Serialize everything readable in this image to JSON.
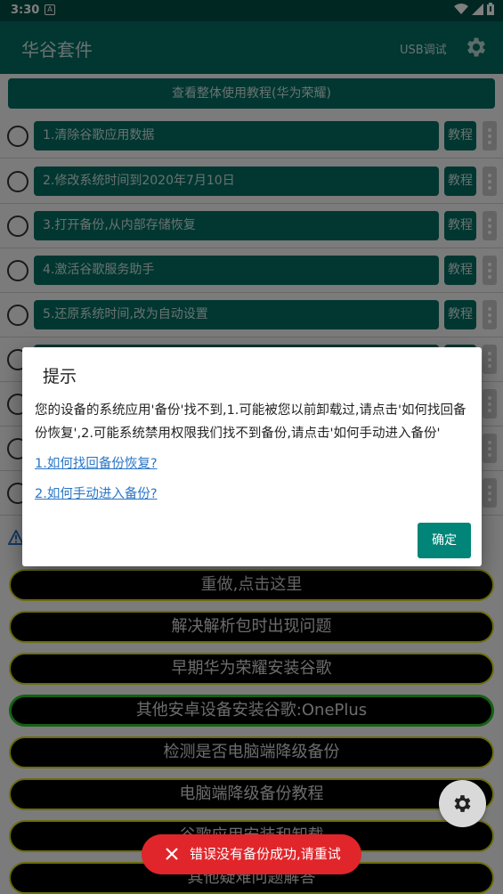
{
  "status_bar": {
    "time": "3:30",
    "notification_icon": "A"
  },
  "app_bar": {
    "title": "华谷套件",
    "usb_debug": "USB调试",
    "settings_icon": "gear-icon"
  },
  "overview_button": "查看整体使用教程(华为荣耀)",
  "steps": [
    {
      "label": "1.清除谷歌应用数据",
      "tutorial": "教程"
    },
    {
      "label": "2.修改系统时间到2020年7月10日",
      "tutorial": "教程"
    },
    {
      "label": "3.打开备份,从内部存储恢复",
      "tutorial": "教程"
    },
    {
      "label": "4.激活谷歌服务助手",
      "tutorial": "教程"
    },
    {
      "label": "5.还原系统时间,改为自动设置",
      "tutorial": "教程"
    },
    {
      "label": "",
      "tutorial": ""
    },
    {
      "label": "",
      "tutorial": ""
    },
    {
      "label": "",
      "tutorial": ""
    },
    {
      "label": "",
      "tutorial": ""
    }
  ],
  "action_buttons": [
    "重做,点击这里",
    "解决解析包时出现问题",
    "早期华为荣耀安装谷歌",
    "其他安卓设备安装谷歌:OnePlus",
    "检测是否电脑端降级备份",
    "电脑端降级备份教程",
    "谷歌应用安装和卸载",
    "其他疑难问题解答"
  ],
  "dialog": {
    "title": "提示",
    "message": "您的设备的系统应用'备份'找不到,1.可能被您以前卸载过,请点击'如何找回备份恢复',2.可能系统禁用权限我们找不到备份,请点击'如何手动进入备份'",
    "link1": "1.如何找回备份恢复?",
    "link2": "2.如何手动进入备份?",
    "confirm": "确定"
  },
  "toast": {
    "text": "错误没有备份成功,请重试",
    "icon": "close-icon"
  },
  "colors": {
    "primary": "#026d62",
    "accent": "#008578",
    "toast": "#e0262b",
    "link": "#2a76c6"
  }
}
